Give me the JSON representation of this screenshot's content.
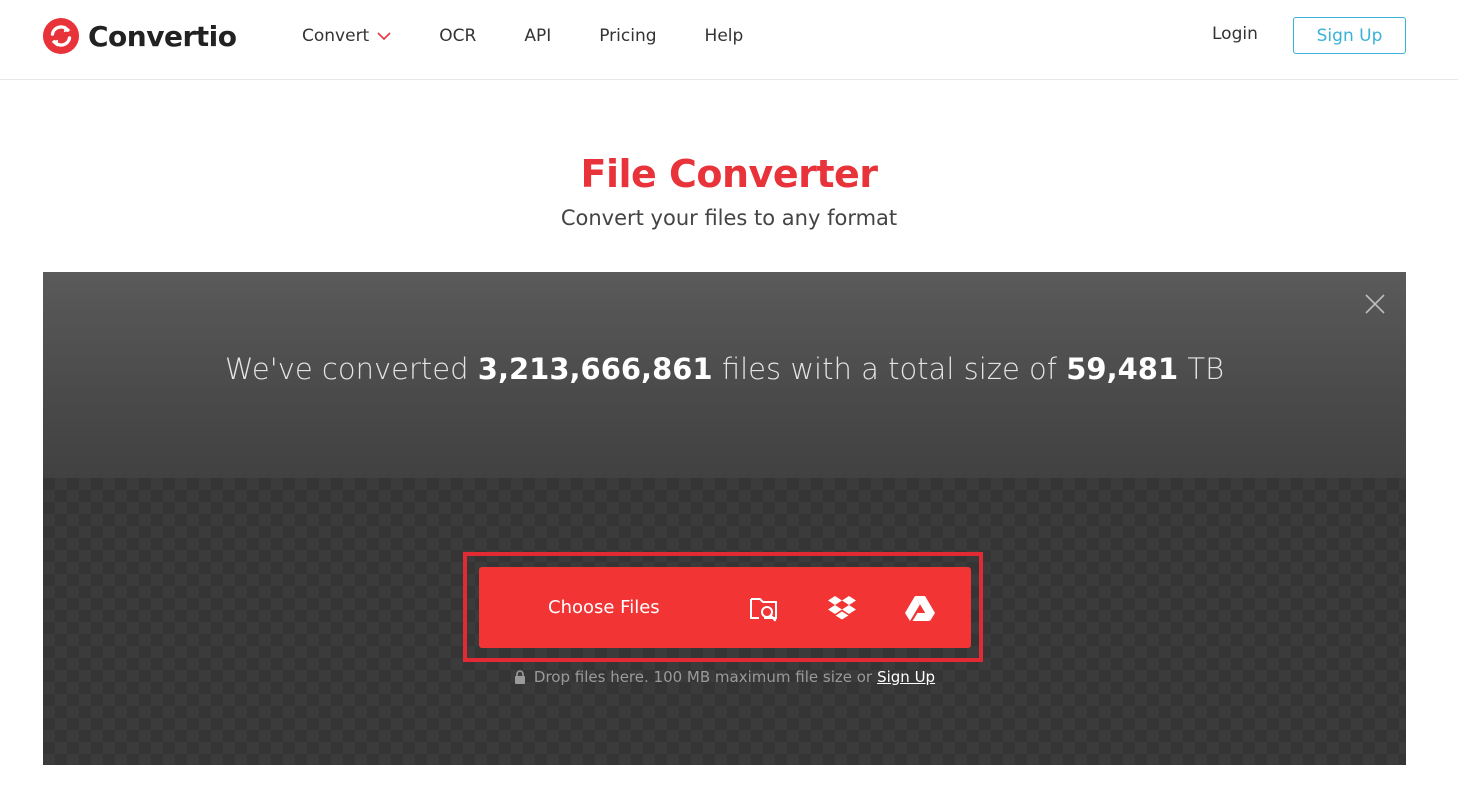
{
  "header": {
    "logo_text": "Convertio",
    "nav": [
      {
        "label": "Convert",
        "has_dropdown": true
      },
      {
        "label": "OCR"
      },
      {
        "label": "API"
      },
      {
        "label": "Pricing"
      },
      {
        "label": "Help"
      }
    ],
    "login_label": "Login",
    "signup_label": "Sign Up"
  },
  "hero": {
    "title": "File Converter",
    "subtitle": "Convert your files to any format"
  },
  "stats": {
    "prefix": "We've converted",
    "files_count": "3,213,666,861",
    "middle": "files with a total size of",
    "total_size": "59,481",
    "unit": "TB"
  },
  "uploader": {
    "choose_label": "Choose Files",
    "sources": [
      "folder-search-icon",
      "dropbox-icon",
      "google-drive-icon"
    ],
    "note_text": "Drop files here. 100 MB maximum file size or",
    "note_link": "Sign Up"
  },
  "colors": {
    "brand_red": "#f23434",
    "title_red": "#e8333a",
    "accent_blue": "#3ab1d7",
    "panel_dark": "#3a3a3a"
  }
}
